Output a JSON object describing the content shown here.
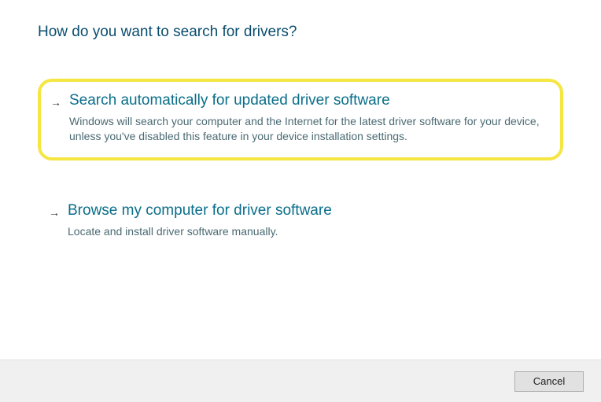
{
  "header": {
    "title": "How do you want to search for drivers?"
  },
  "options": [
    {
      "title": "Search automatically for updated driver software",
      "description": "Windows will search your computer and the Internet for the latest driver software for your device, unless you've disabled this feature in your device installation settings.",
      "highlighted": true
    },
    {
      "title": "Browse my computer for driver software",
      "description": "Locate and install driver software manually.",
      "highlighted": false
    }
  ],
  "footer": {
    "cancel_label": "Cancel"
  }
}
